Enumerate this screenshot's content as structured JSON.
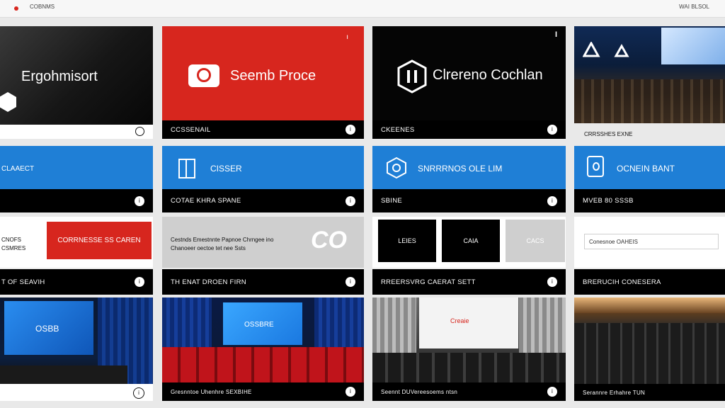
{
  "topbar": {
    "left_text": "COBNMS",
    "right_text": "WAI BLSOL"
  },
  "row1": {
    "tile1": {
      "title": "Ergohmisort"
    },
    "tile2": {
      "title": "Seemb Proce",
      "bar": "CCSSENAIL"
    },
    "tile3": {
      "title": "Clrereno Cochlan",
      "bar": "CKEENES",
      "mark": "I"
    },
    "tile4": {
      "caption": "CRRSSHES EXNE"
    }
  },
  "row2": {
    "tile1": {
      "label": "CLAAECT"
    },
    "tile2": {
      "label": "CISSER",
      "bar": "COTAE KHRA SPANE"
    },
    "tile3": {
      "label": "SNRRRNOS OLE LIM",
      "bar": "SBINE"
    },
    "tile4": {
      "label": "OCNEIN BANT",
      "bar": "MVEB 80 SSSB"
    }
  },
  "row3": {
    "tile1": {
      "text1": "CNOFS",
      "text2": "CSMRES",
      "red_button": "CORRNESSE SS CAREN"
    },
    "tile2": {
      "text1": "Cestnds Emestnnte Papnoe Chrngee ino",
      "text2": "Chanoeer oectoe tet nee Ssts",
      "logo": "CO"
    },
    "tile3": {
      "box1": "LEIES",
      "box2": "CAIA",
      "box3": "CACS"
    },
    "tile4": {
      "input_value": "Conesnoe OAHEIS"
    }
  },
  "row3bars": {
    "tile1": "T OF SEAVIH",
    "tile2": "TH ENAT DROEN FIRN",
    "tile3": "RREERSVRG CAERAT SETT",
    "tile4": "BRERUCIH CONESERA"
  },
  "row4": {
    "tile1": {
      "screen_text": "OSBB"
    },
    "tile2": {
      "screen_text": "OSSBRE",
      "bar": "Gresnntoe Uhenhre SEXBIHE"
    },
    "tile3": {
      "screen_text": "Creaie",
      "bar": "Seennt DUVereesoems ntsn"
    },
    "tile4": {
      "bar": "Serannre Erhahre TUN"
    }
  },
  "colors": {
    "red": "#d7261e",
    "blue": "#1f7fd6",
    "black": "#000000"
  }
}
